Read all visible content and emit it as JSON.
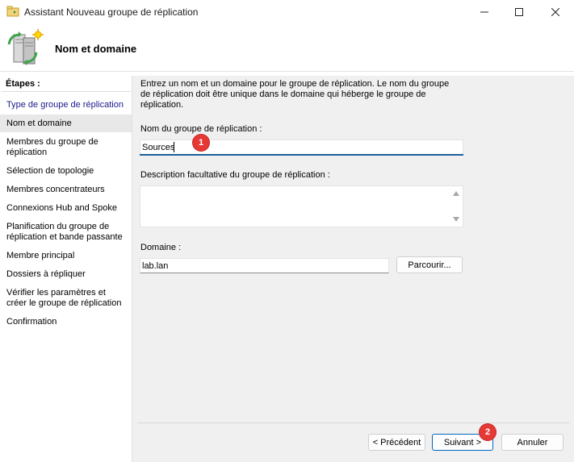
{
  "window": {
    "title": "Assistant Nouveau groupe de réplication",
    "controls": [
      "minimize-icon",
      "maximize-icon",
      "close-icon"
    ]
  },
  "header": {
    "title": "Nom et domaine",
    "icon": "replication-server-icon"
  },
  "sidebar": {
    "label": "Étapes :",
    "items": [
      {
        "label": "Type de groupe de réplication",
        "state": "link"
      },
      {
        "label": "Nom et domaine",
        "state": "current"
      },
      {
        "label": "Membres du groupe de réplication"
      },
      {
        "label": "Sélection de topologie"
      },
      {
        "label": "Membres concentrateurs"
      },
      {
        "label": "Connexions Hub and Spoke"
      },
      {
        "label": "Planification du groupe de réplication et bande passante"
      },
      {
        "label": "Membre principal"
      },
      {
        "label": "Dossiers à répliquer"
      },
      {
        "label": "Vérifier les paramètres et créer le groupe de réplication"
      },
      {
        "label": "Confirmation"
      }
    ]
  },
  "main": {
    "intro": "Entrez un nom et un domaine pour le groupe de réplication. Le nom du groupe de réplication doit être unique dans le domaine qui héberge le groupe de réplication.",
    "name_label": "Nom du groupe de réplication :",
    "name_value": "Sources",
    "description_label": "Description facultative du groupe de réplication :",
    "description_value": "",
    "domain_label": "Domaine :",
    "domain_value": "lab.lan",
    "browse_label": "Parcourir..."
  },
  "footer": {
    "previous_label": "< Précédent",
    "next_label": "Suivant >",
    "cancel_label": "Annuler"
  },
  "annotations": {
    "badge1": "1",
    "badge2": "2"
  },
  "colors": {
    "accent": "#0067c0",
    "badge": "#e53935",
    "link": "#1a1a8c",
    "pane_background": "#f0f0f0"
  }
}
